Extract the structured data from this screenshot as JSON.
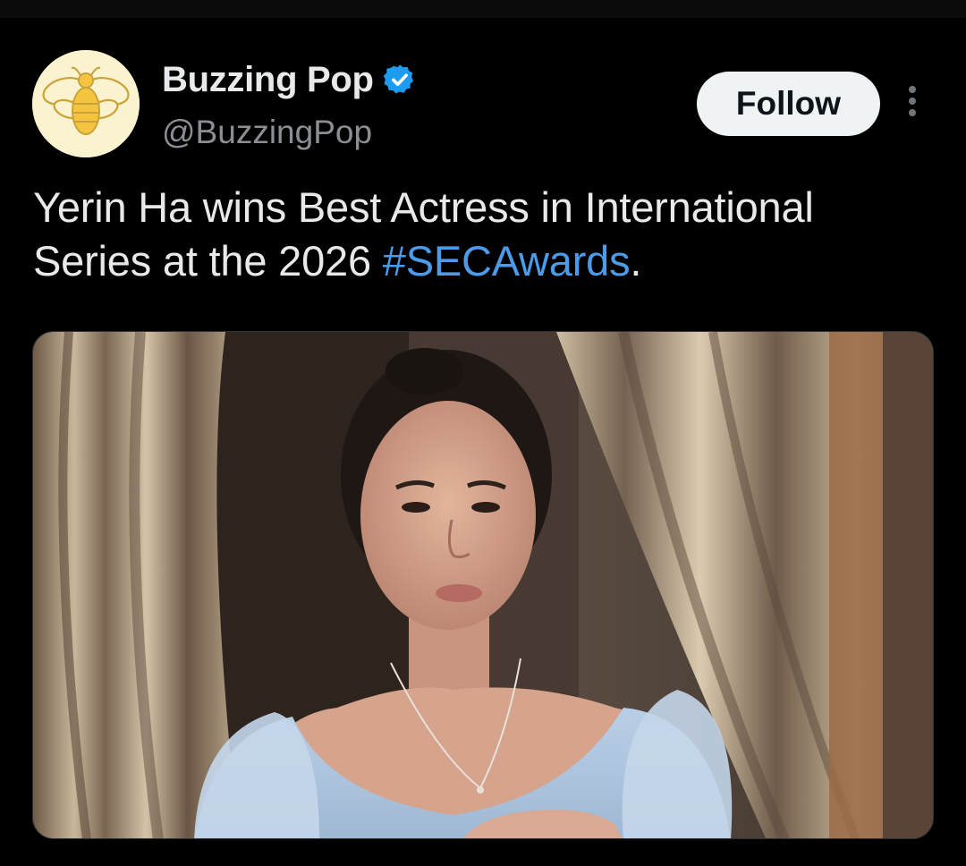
{
  "post": {
    "author": {
      "display_name": "Buzzing Pop",
      "handle": "@BuzzingPop",
      "verified": true,
      "avatar_icon": "bee-icon"
    },
    "follow_label": "Follow",
    "more_icon": "more-vertical-icon",
    "text_main": "Yerin Ha wins Best Actress in International Series at the 2026 ",
    "hashtag": "#SECAwards",
    "text_end": ".",
    "colors": {
      "background": "#000000",
      "text": "#e7e9ea",
      "muted": "#8b8f94",
      "link": "#4c9be8",
      "verified_badge": "#1d9bf0",
      "follow_bg": "#eff3f4"
    }
  }
}
